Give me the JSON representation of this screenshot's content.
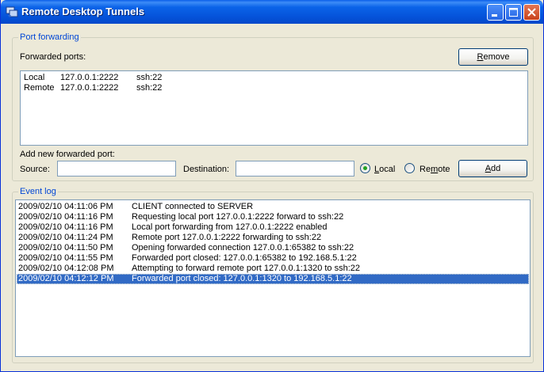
{
  "window": {
    "title": "Remote Desktop Tunnels"
  },
  "port_forwarding": {
    "group_label": "Port forwarding",
    "forwarded_label": "Forwarded ports:",
    "remove_label": "Remove",
    "ports": [
      {
        "type": "Local",
        "address": "127.0.0.1:2222",
        "target": "ssh:22"
      },
      {
        "type": "Remote",
        "address": "127.0.0.1:2222",
        "target": "ssh:22"
      }
    ],
    "add_new_label": "Add new forwarded port:",
    "source_label": "Source:",
    "source_value": "",
    "destination_label": "Destination:",
    "destination_value": "",
    "local_label": "Local",
    "remote_label": "Remote",
    "selected_mode": "Local",
    "add_label": "Add"
  },
  "event_log": {
    "group_label": "Event log",
    "entries": [
      {
        "time": "2009/02/10 04:11:06 PM",
        "message": "CLIENT connected to SERVER"
      },
      {
        "time": "2009/02/10 04:11:16 PM",
        "message": "Requesting local port 127.0.0.1:2222 forward to ssh:22"
      },
      {
        "time": "2009/02/10 04:11:16 PM",
        "message": "Local port forwarding from 127.0.0.1:2222 enabled"
      },
      {
        "time": "2009/02/10 04:11:24 PM",
        "message": "Remote port 127.0.0.1:2222 forwarding to ssh:22"
      },
      {
        "time": "2009/02/10 04:11:50 PM",
        "message": "Opening forwarded connection 127.0.0.1:65382 to ssh:22"
      },
      {
        "time": "2009/02/10 04:11:55 PM",
        "message": "Forwarded port closed: 127.0.0.1:65382 to 192.168.5.1:22"
      },
      {
        "time": "2009/02/10 04:12:08 PM",
        "message": "Attempting to forward remote port 127.0.0.1:1320 to ssh:22"
      },
      {
        "time": "2009/02/10 04:12:12 PM",
        "message": "Forwarded port closed: 127.0.0.1:1320 to 192.168.5.1:22"
      }
    ],
    "selected_index": 7
  },
  "colors": {
    "titlebar": "#0554DA",
    "group_label": "#0046D5",
    "selection": "#316AC5",
    "face": "#ECE9D8"
  },
  "icons": [
    "app-icon",
    "minimize-icon",
    "maximize-icon",
    "close-icon"
  ]
}
